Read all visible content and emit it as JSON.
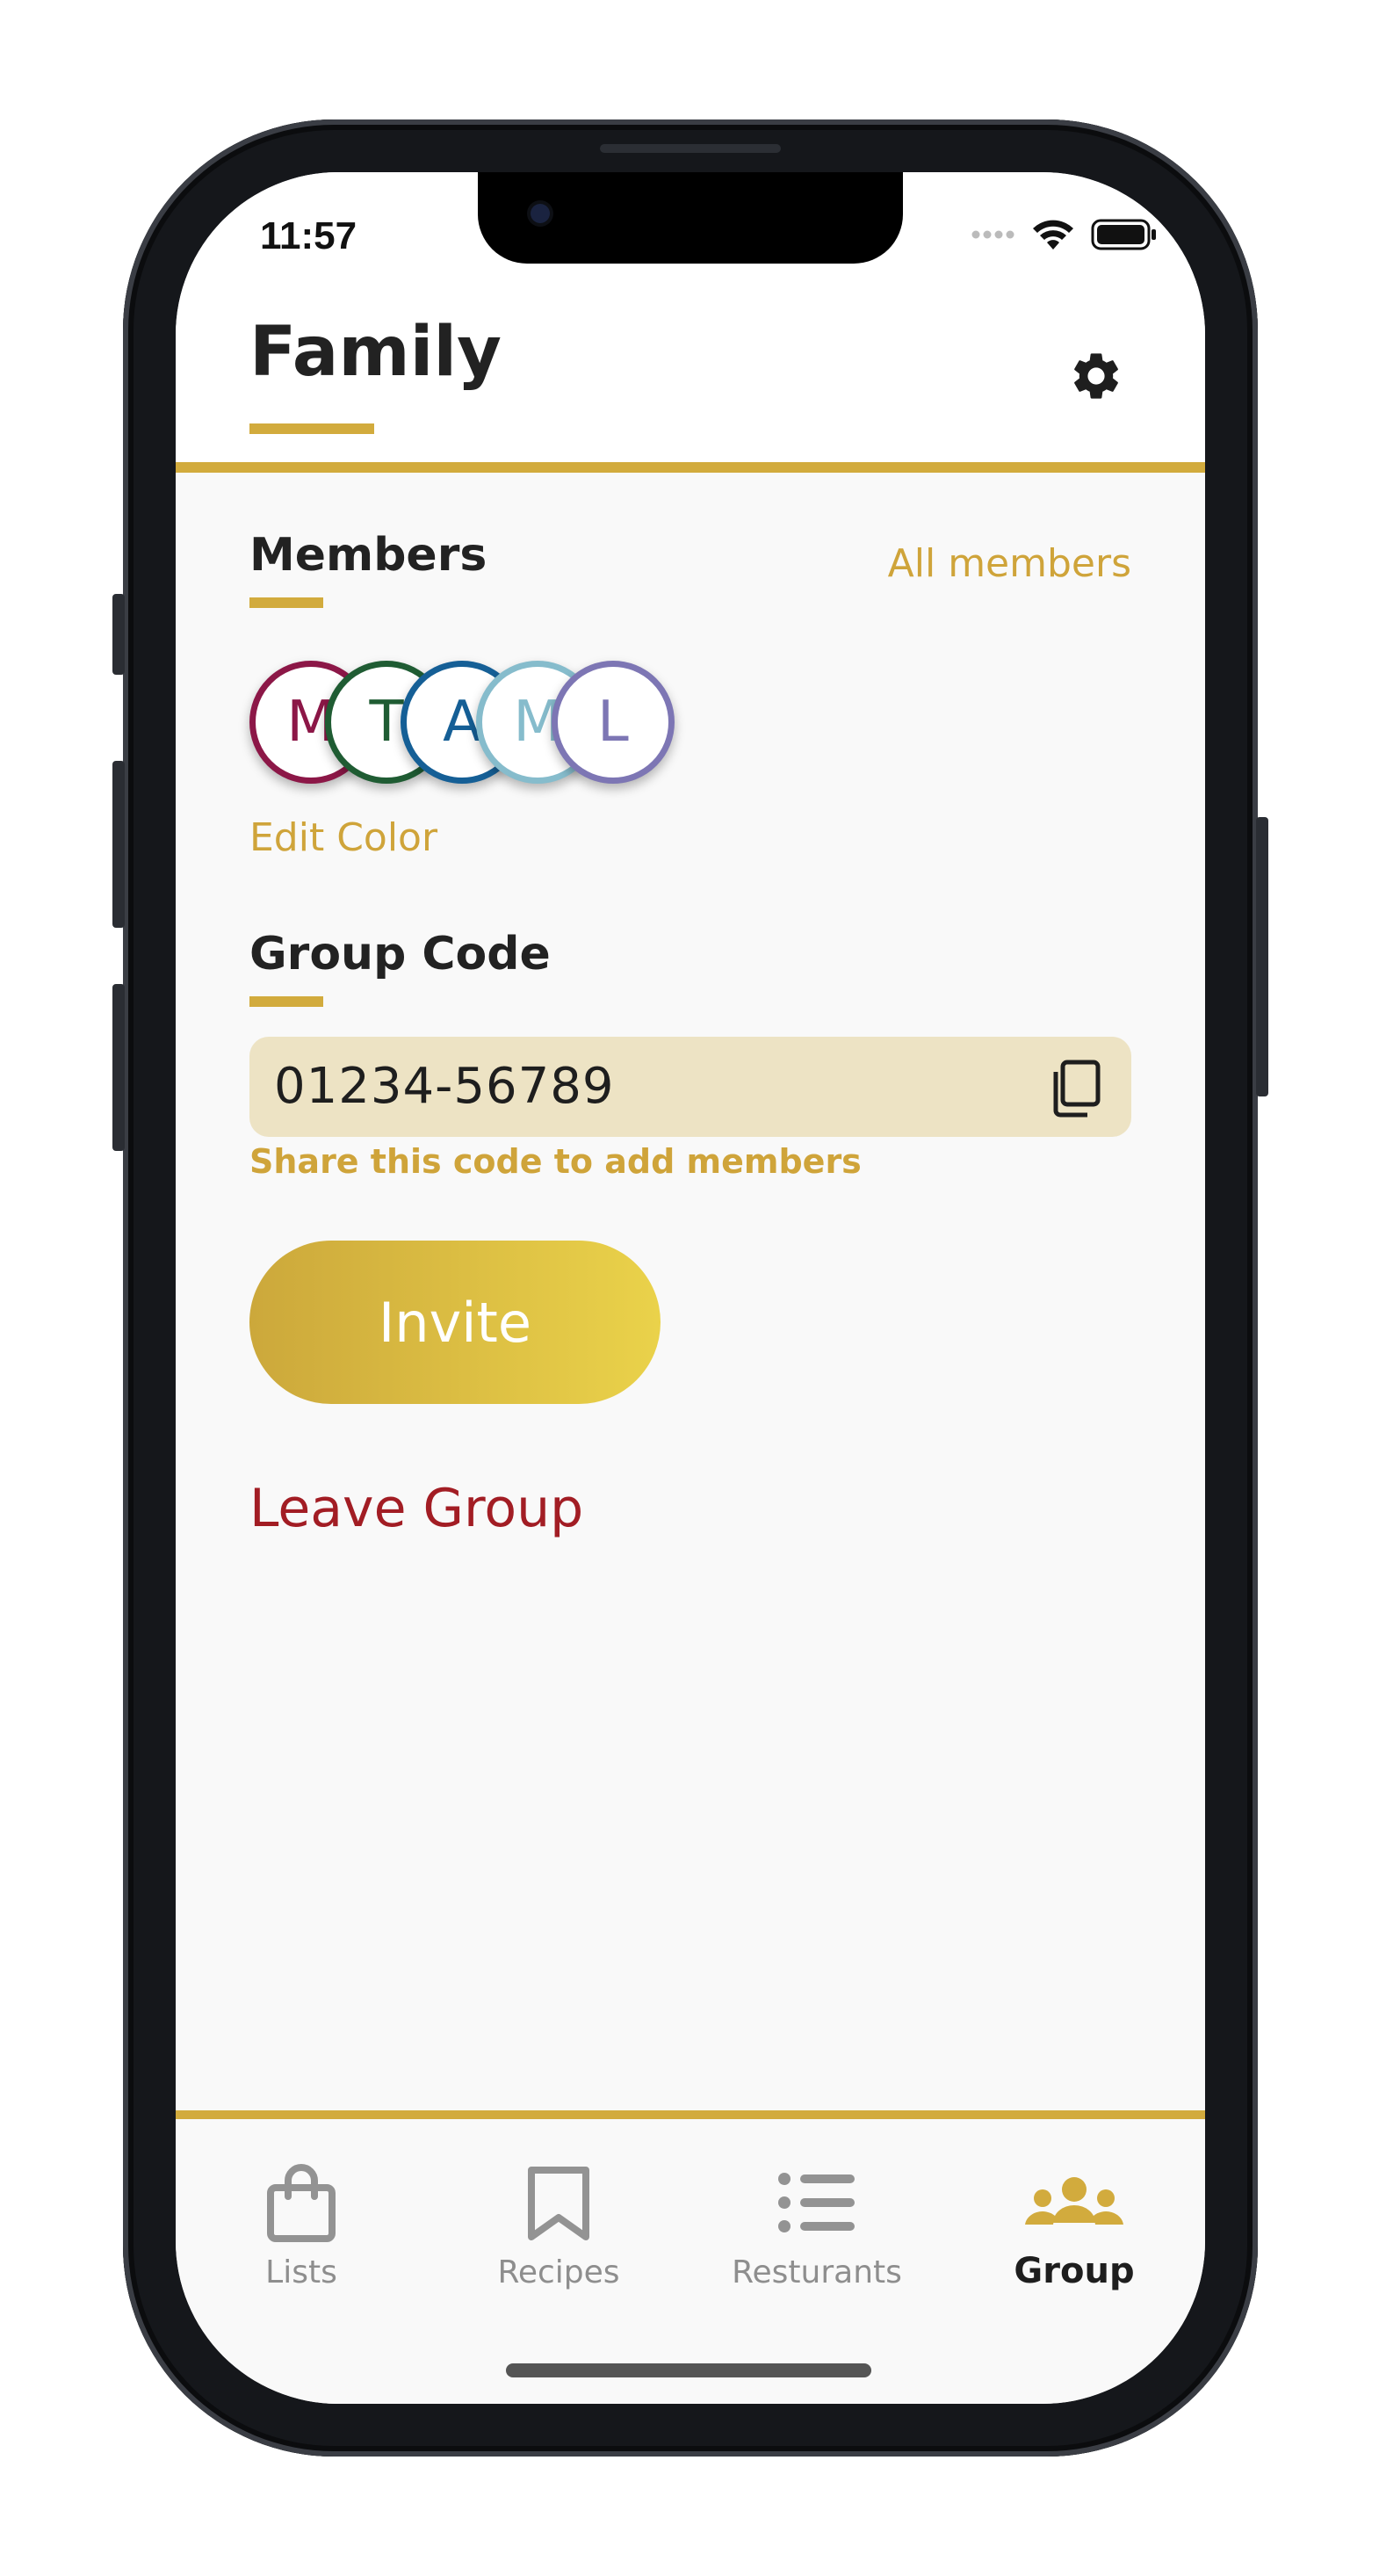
{
  "status_bar": {
    "time": "11:57"
  },
  "header": {
    "title": "Family",
    "accent_color": "#d2ab3d",
    "settings_icon": "gear-icon"
  },
  "members": {
    "title": "Members",
    "all_members_link": "All members",
    "avatars": [
      {
        "initial": "M",
        "color": "#8c1747"
      },
      {
        "initial": "T",
        "color": "#1f5c33"
      },
      {
        "initial": "A",
        "color": "#155f96"
      },
      {
        "initial": "M",
        "color": "#86bccc"
      },
      {
        "initial": "L",
        "color": "#7d76b4"
      }
    ],
    "edit_color_link": "Edit Color"
  },
  "group_code": {
    "title": "Group Code",
    "code": "01234-56789",
    "copy_icon": "copy-icon",
    "hint": "Share this code to add members"
  },
  "actions": {
    "invite_label": "Invite",
    "leave_label": "Leave Group",
    "leave_color": "#a21d24"
  },
  "tab_bar": {
    "tabs": [
      {
        "label": "Lists",
        "icon": "shopping-bag-icon",
        "active": false
      },
      {
        "label": "Recipes",
        "icon": "bookmark-icon",
        "active": false
      },
      {
        "label": "Resturants",
        "icon": "list-icon",
        "active": false
      },
      {
        "label": "Group",
        "icon": "people-group-icon",
        "active": true
      }
    ]
  }
}
